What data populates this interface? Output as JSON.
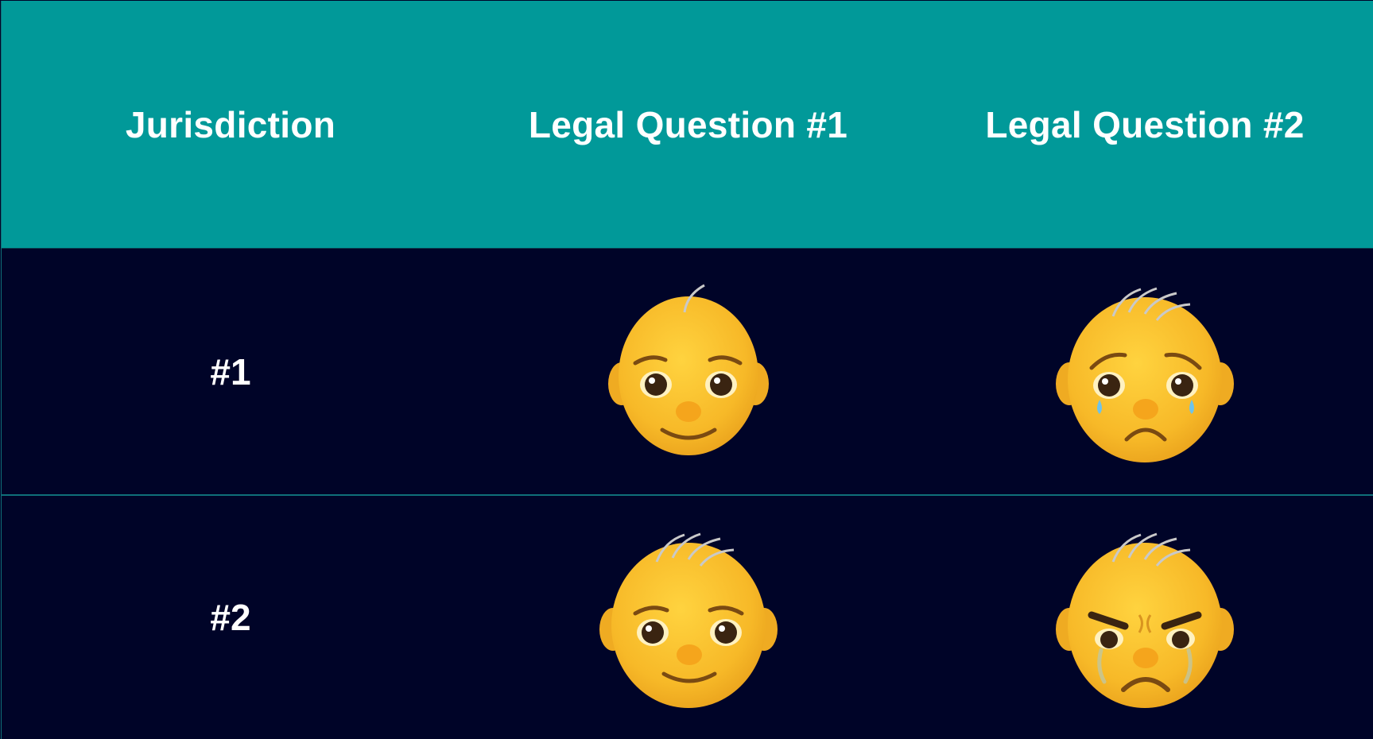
{
  "table": {
    "headers": [
      "Jurisdiction",
      "Legal Question #1",
      "Legal Question #2"
    ],
    "rows": [
      {
        "label": "#1",
        "q1_icon": "smiling-baby-icon",
        "q2_icon": "crying-baby-icon"
      },
      {
        "label": "#2",
        "q1_icon": "smiling-baby-icon",
        "q2_icon": "angry-crying-baby-icon"
      }
    ]
  },
  "colors": {
    "header_bg": "#019999",
    "body_bg": "#000428",
    "text": "#ffffff",
    "face": "#f9c02e"
  }
}
